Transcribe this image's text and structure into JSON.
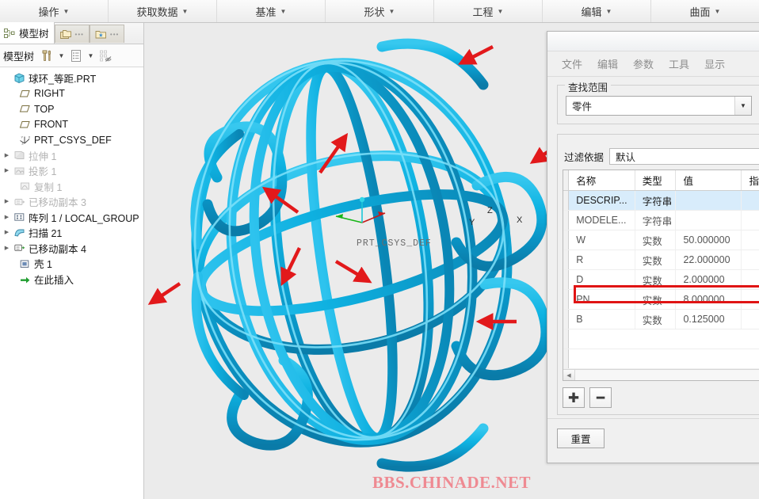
{
  "ribbon": {
    "items": [
      {
        "label": "操作",
        "caret": "▼"
      },
      {
        "label": "获取数据",
        "caret": "▼"
      },
      {
        "label": "基准",
        "caret": "▼"
      },
      {
        "label": "形状",
        "caret": "▼"
      },
      {
        "label": "工程",
        "caret": "▼"
      },
      {
        "label": "编辑",
        "caret": "▼"
      },
      {
        "label": "曲面",
        "caret": "▼"
      }
    ]
  },
  "left_panel": {
    "tab_label": "模型树",
    "tab_dots": "•••",
    "toolbar_label": "模型树",
    "tree": [
      {
        "label": "球环_等距.PRT",
        "icon": "part-icon",
        "arrow": "",
        "dim": false,
        "indent": 0
      },
      {
        "label": "RIGHT",
        "icon": "plane-icon",
        "arrow": "",
        "dim": false,
        "indent": 1
      },
      {
        "label": "TOP",
        "icon": "plane-icon",
        "arrow": "",
        "dim": false,
        "indent": 1
      },
      {
        "label": "FRONT",
        "icon": "plane-icon",
        "arrow": "",
        "dim": false,
        "indent": 1
      },
      {
        "label": "PRT_CSYS_DEF",
        "icon": "csys-icon",
        "arrow": "",
        "dim": false,
        "indent": 1
      },
      {
        "label": "拉伸 1",
        "icon": "extrude-icon",
        "arrow": "▶",
        "dim": true,
        "indent": 0
      },
      {
        "label": "投影 1",
        "icon": "project-icon",
        "arrow": "▶",
        "dim": true,
        "indent": 0
      },
      {
        "label": "复制 1",
        "icon": "copy-icon",
        "arrow": "",
        "dim": true,
        "indent": 0
      },
      {
        "label": "已移动副本 3",
        "icon": "moved-icon",
        "arrow": "▶",
        "dim": true,
        "indent": 0
      },
      {
        "label": "阵列 1 / LOCAL_GROUP",
        "icon": "pattern-icon",
        "arrow": "▶",
        "dim": false,
        "indent": 0
      },
      {
        "label": "扫描 21",
        "icon": "sweep-icon",
        "arrow": "▶",
        "dim": false,
        "indent": 0
      },
      {
        "label": "已移动副本 4",
        "icon": "moved-icon",
        "arrow": "▶",
        "dim": false,
        "indent": 0
      },
      {
        "label": "壳 1",
        "icon": "shell-icon",
        "arrow": "",
        "dim": false,
        "indent": 1
      },
      {
        "label": "在此插入",
        "icon": "insert-icon",
        "arrow": "",
        "dim": false,
        "indent": 1
      }
    ]
  },
  "viewport": {
    "csys_label": "PRT_CSYS_DEF",
    "axis_x": "X",
    "axis_y": "Y",
    "axis_z": "Z",
    "watermark": "BBS.CHINADE.NET",
    "model_color": "#1cb8e0",
    "arrow_color": "#e2191b",
    "background": "#ebebeb"
  },
  "dialog": {
    "menu": [
      "文件",
      "编辑",
      "参数",
      "工具",
      "显示"
    ],
    "search_scope": {
      "legend": "查找范围",
      "value": "零件",
      "caret": "▼"
    },
    "filter": {
      "label": "过滤依据",
      "value": "默认"
    },
    "table": {
      "headers": [
        "名称",
        "类型",
        "值",
        "指"
      ],
      "rows": [
        {
          "name": "DESCRIP...",
          "type": "字符串",
          "value": "",
          "selected": true,
          "strong": false
        },
        {
          "name": "MODELE...",
          "type": "字符串",
          "value": "",
          "selected": false,
          "strong": false
        },
        {
          "name": "W",
          "type": "实数",
          "value": "50.000000",
          "selected": false,
          "strong": true
        },
        {
          "name": "R",
          "type": "实数",
          "value": "22.000000",
          "selected": false,
          "strong": true
        },
        {
          "name": "D",
          "type": "实数",
          "value": "2.000000",
          "selected": false,
          "strong": true
        },
        {
          "name": "PN",
          "type": "实数",
          "value": "8.000000",
          "selected": false,
          "strong": true,
          "highlighted": true
        },
        {
          "name": "B",
          "type": "实数",
          "value": "0.125000",
          "selected": false,
          "strong": false
        }
      ]
    },
    "add_button": "✚",
    "remove_button": "━",
    "reset_button": "重置",
    "highlight_color": "#e01414"
  }
}
